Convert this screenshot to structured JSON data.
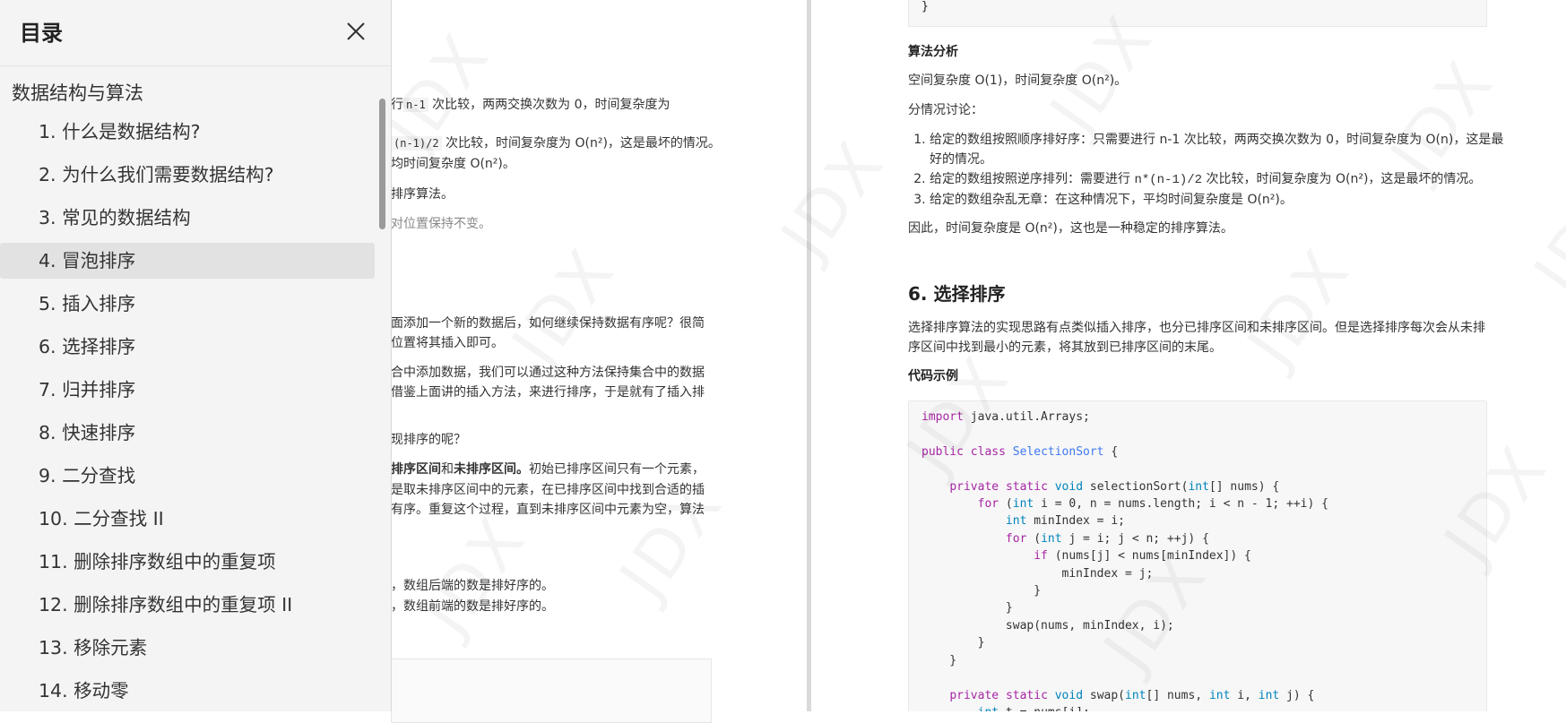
{
  "toc": {
    "title": "目录",
    "close_label": "×",
    "section": "数据结构与算法",
    "active_index": 3,
    "items": [
      "1. 什么是数据结构?",
      "2. 为什么我们需要数据结构?",
      "3. 常见的数据结构",
      "4. 冒泡排序",
      "5. 插入排序",
      "6. 选择排序",
      "7. 归并排序",
      "8. 快速排序",
      "9. 二分查找",
      "10. 二分查找 II",
      "11. 删除排序数组中的重复项",
      "12. 删除排序数组中的重复项 II",
      "13. 移除元素",
      "14. 移动零"
    ]
  },
  "left_page": {
    "l1a": "行",
    "l1code": "n-1",
    "l1b": " 次比较，两两交换次数为 0，时间复杂度为",
    "l2code": "(n-1)/2",
    "l2b": " 次比较，时间复杂度为 O(n²)，这是最坏的情况。",
    "l3": "均时间复杂度 O(n²)。",
    "l4": "排序算法。",
    "l5": "对位置保持不变。",
    "l6": "面添加一个新的数据后，如何继续保持数据有序呢？很简",
    "l7": "位置将其插入即可。",
    "l8": "合中添加数据，我们可以通过这种方法保持集合中的数据",
    "l9": "借鉴上面讲的插入方法，来进行排序，于是就有了插入排",
    "l10": "现排序的呢？",
    "l11a": "排序区间",
    "l11b": "和",
    "l11c": "未排序区间。",
    "l11d": "初始已排序区间只有一个元素，",
    "l12": "是取未排序区间中的元素，在已排序区间中找到合适的插",
    "l13": "有序。重复这个过程，直到未排序区间中元素为空，算法",
    "l14": "，数组后端的数是排好序的。",
    "l15": "，数组前端的数是排好序的。"
  },
  "right_page": {
    "code_top": "}",
    "analysis_title": "算法分析",
    "complexity": "空间复杂度 O(1)，时间复杂度 O(n²)。",
    "cases_intro": "分情况讨论：",
    "case1": "给定的数组按照顺序排好序：只需要进行 n-1 次比较，两两交换次数为 0，时间复杂度为 O(n)，这是最好的情况。",
    "case2a": "给定的数组按照逆序排列：需要进行 ",
    "case2code": "n*(n-1)/2",
    "case2b": " 次比较，时间复杂度为 O(n²)，这是最坏的情况。",
    "case3": "给定的数组杂乱无章：在这种情况下，平均时间复杂度是 O(n²)。",
    "conclusion": "因此，时间复杂度是 O(n²)，这也是一种稳定的排序算法。",
    "section_title": "6. 选择排序",
    "desc": "选择排序算法的实现思路有点类似插入排序，也分已排序区间和未排序区间。但是选择排序每次会从未排序区间中找到最小的元素，将其放到已排序区间的末尾。",
    "code_title": "代码示例",
    "code_lines": [
      "import java.util.Arrays;",
      "",
      "public class SelectionSort {",
      "",
      "    private static void selectionSort(int[] nums) {",
      "        for (int i = 0, n = nums.length; i < n - 1; ++i) {",
      "            int minIndex = i;",
      "            for (int j = i; j < n; ++j) {",
      "                if (nums[j] < nums[minIndex]) {",
      "                    minIndex = j;",
      "                }",
      "            }",
      "            swap(nums, minIndex, i);",
      "        }",
      "    }",
      "",
      "    private static void swap(int[] nums, int i, int j) {",
      "        int t = nums[i];"
    ]
  },
  "watermark": "JDX"
}
